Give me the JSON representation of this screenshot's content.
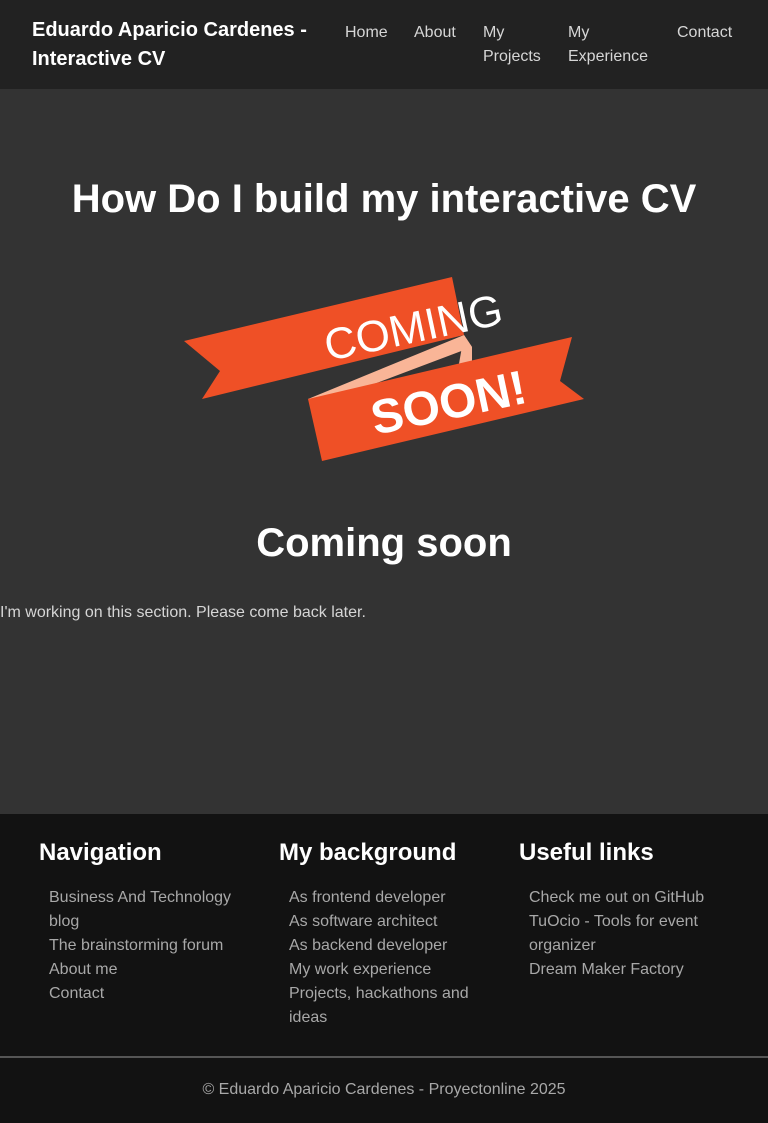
{
  "header": {
    "brand": "Eduardo Aparicio Cardenes - Interactive CV",
    "nav": [
      "Home",
      "About",
      "My Projects",
      "My Experience",
      "Contact"
    ]
  },
  "main": {
    "title": "How Do I build my interactive CV",
    "banner": {
      "line1": "COMING",
      "line2": "SOON!",
      "ribbon_color": "#ef5026",
      "fold_color": "#f9b597"
    },
    "subtitle": "Coming soon",
    "message": "I'm working on this section. Please come back later."
  },
  "footer": {
    "columns": [
      {
        "heading": "Navigation",
        "links": [
          "Business And Technology blog",
          "The brainstorming forum",
          "About me",
          "Contact"
        ]
      },
      {
        "heading": "My background",
        "links": [
          "As frontend developer",
          "As software architect",
          "As backend developer",
          "My work experience",
          "Projects, hackathons and ideas"
        ]
      },
      {
        "heading": "Useful links",
        "links": [
          "Check me out on GitHub",
          "TuOcio - Tools for event organizer",
          "Dream Maker Factory"
        ]
      }
    ],
    "copyright": "© Eduardo Aparicio Cardenes - Proyectonline 2025"
  }
}
